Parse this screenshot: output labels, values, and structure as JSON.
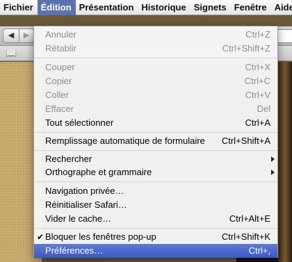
{
  "menubar": {
    "items": [
      "Fichier",
      "Édition",
      "Présentation",
      "Historique",
      "Signets",
      "Fenêtre",
      "Aide"
    ],
    "active": "Édition"
  },
  "menu": {
    "items": [
      {
        "label": "Annuler",
        "shortcut": "Ctrl+Z",
        "enabled": false
      },
      {
        "label": "Rétablir",
        "shortcut": "Ctrl+Shift+Z",
        "enabled": false
      },
      {
        "label": "Couper",
        "shortcut": "Ctrl+X",
        "enabled": false
      },
      {
        "label": "Copier",
        "shortcut": "Ctrl+C",
        "enabled": false
      },
      {
        "label": "Coller",
        "shortcut": "Ctrl+V",
        "enabled": false
      },
      {
        "label": "Effacer",
        "shortcut": "Del",
        "enabled": false
      },
      {
        "label": "Tout sélectionner",
        "shortcut": "Ctrl+A",
        "enabled": true
      },
      {
        "label": "Remplissage automatique de formulaire",
        "shortcut": "Ctrl+Shift+A",
        "enabled": true
      },
      {
        "label": "Rechercher",
        "shortcut": "",
        "enabled": true,
        "submenu": true
      },
      {
        "label": "Orthographe et grammaire",
        "shortcut": "",
        "enabled": true,
        "submenu": true
      },
      {
        "label": "Navigation privée…",
        "shortcut": "",
        "enabled": true
      },
      {
        "label": "Réinitialiser Safari…",
        "shortcut": "",
        "enabled": true
      },
      {
        "label": "Vider le cache…",
        "shortcut": "Ctrl+Alt+E",
        "enabled": true
      },
      {
        "label": "Bloquer les fenêtres pop-up",
        "shortcut": "Ctrl+Shift+K",
        "enabled": true,
        "checked": true
      },
      {
        "label": "Préférences…",
        "shortcut": "Ctrl+,",
        "enabled": true,
        "highlighted": true
      }
    ]
  },
  "colors": {
    "menubar_active": "#5a72b0",
    "highlight": "#3b58c4",
    "disabled_text": "#8d8d8d"
  }
}
